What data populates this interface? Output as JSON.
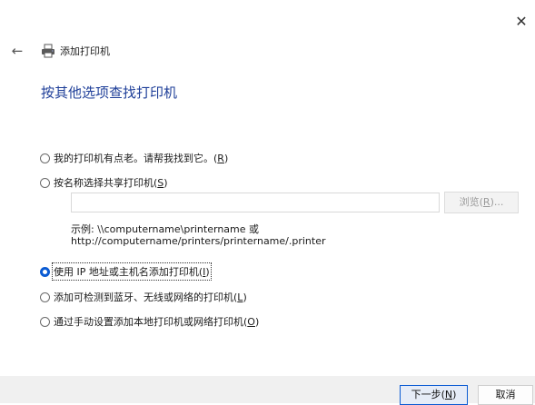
{
  "window": {
    "close_glyph": "✕",
    "back_glyph": "←",
    "title": "添加打印机"
  },
  "heading": "按其他选项查找打印机",
  "options": [
    {
      "text": "我的打印机有点老。请帮我找到它。(",
      "hotkey": "R",
      "suffix": ")",
      "checked": false
    },
    {
      "text": "按名称选择共享打印机(",
      "hotkey": "S",
      "suffix": ")",
      "checked": false
    },
    {
      "text": "使用 IP 地址或主机名添加打印机(",
      "hotkey": "I",
      "suffix": ")",
      "checked": true
    },
    {
      "text": "添加可检测到蓝牙、无线或网络的打印机(",
      "hotkey": "L",
      "suffix": ")",
      "checked": false
    },
    {
      "text": "通过手动设置添加本地打印机或网络打印机(",
      "hotkey": "O",
      "suffix": ")",
      "checked": false
    }
  ],
  "share_input": {
    "value": "",
    "placeholder": ""
  },
  "browse": {
    "text": "浏览(",
    "hotkey": "R",
    "suffix": ")..."
  },
  "example": {
    "line1": "示例: \\\\computername\\printername 或",
    "line2": "http://computername/printers/printername/.printer"
  },
  "buttons": {
    "next": {
      "text": "下一步(",
      "hotkey": "N",
      "suffix": ")"
    },
    "cancel": "取消"
  },
  "colors": {
    "accent": "#0b5bd3",
    "heading": "#1f3f99",
    "footer_bg": "#f0f0f0"
  },
  "icons": {
    "printer": "printer-icon",
    "back": "back-arrow-icon",
    "close": "close-icon"
  }
}
